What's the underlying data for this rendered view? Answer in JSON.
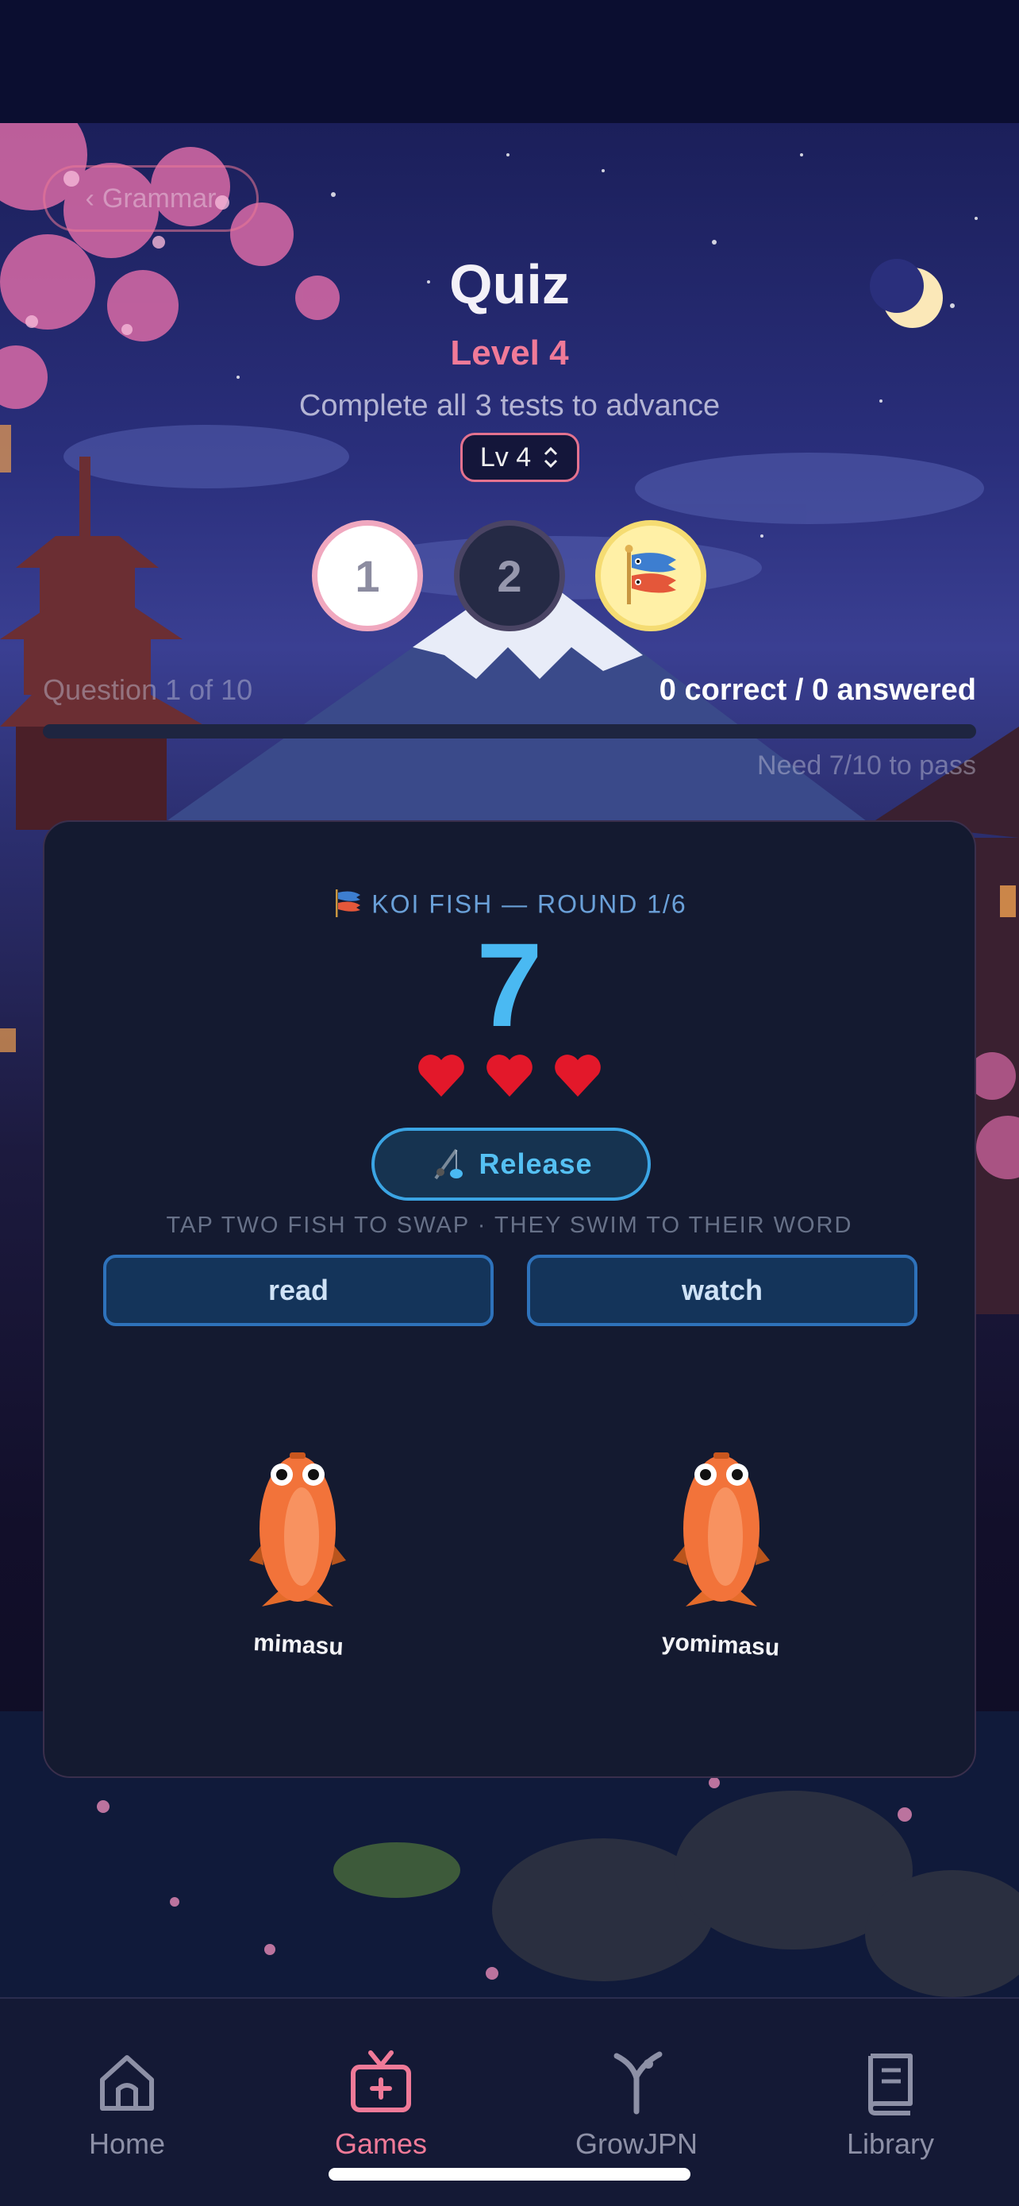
{
  "header": {
    "back_label": "Grammar",
    "title": "Quiz",
    "level": "Level 4",
    "subtitle": "Complete all 3 tests to advance",
    "level_select": "Lv 4"
  },
  "tests": [
    {
      "label": "1",
      "state": "current"
    },
    {
      "label": "2",
      "state": "locked"
    },
    {
      "icon": "koi-streamer-icon",
      "state": "special"
    }
  ],
  "progress": {
    "question": "Question 1 of 10",
    "score": "0 correct / 0 answered",
    "need": "Need 7/10 to pass",
    "fraction": 0.0
  },
  "game": {
    "round_label": "KOI FISH — ROUND 1/6",
    "timer": "7",
    "lives": 3,
    "release_label": "Release",
    "instruction": "TAP TWO FISH TO SWAP · THEY SWIM TO THEIR WORD",
    "targets": [
      "read",
      "watch"
    ],
    "fish": [
      "mimasu",
      "yomimasu"
    ]
  },
  "tabbar": {
    "items": [
      {
        "label": "Home",
        "icon": "home-icon",
        "active": false
      },
      {
        "label": "Games",
        "icon": "games-tv-icon",
        "active": true
      },
      {
        "label": "GrowJPN",
        "icon": "growjpn-icon",
        "active": false
      },
      {
        "label": "Library",
        "icon": "library-book-icon",
        "active": false
      }
    ]
  },
  "colors": {
    "accent_pink": "#f07a98",
    "accent_blue": "#4ab9f2",
    "card_bg": "#141a30",
    "tabbar_bg": "#141935"
  }
}
